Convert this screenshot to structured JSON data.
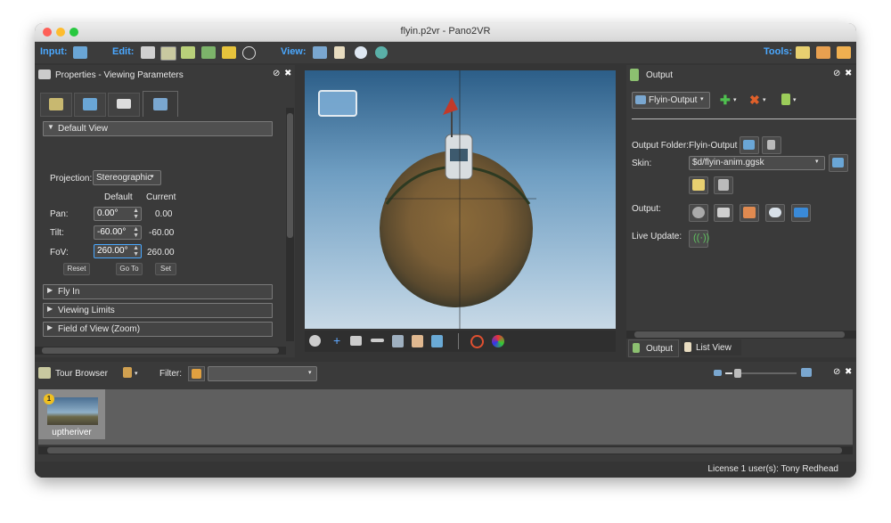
{
  "window": {
    "title": "flyin.p2vr - Pano2VR"
  },
  "toolbar": {
    "input_label": "Input:",
    "edit_label": "Edit:",
    "view_label": "View:",
    "tools_label": "Tools:"
  },
  "properties": {
    "title": "Properties - Viewing Parameters",
    "default_view": "Default View",
    "projection_label": "Projection:",
    "projection_value": "Stereographic",
    "col_default": "Default",
    "col_current": "Current",
    "pan_label": "Pan:",
    "pan_default": "0.00°",
    "pan_current": "0.00",
    "tilt_label": "Tilt:",
    "tilt_default": "-60.00°",
    "tilt_current": "-60.00",
    "fov_label": "FoV:",
    "fov_default": "260.00°",
    "fov_current": "260.00",
    "reset": "Reset",
    "goto": "Go To",
    "set": "Set",
    "fly_in": "Fly In",
    "viewing_limits": "Viewing Limits",
    "fov_zoom": "Field of View (Zoom)"
  },
  "output": {
    "title": "Output",
    "profile": "Flyin-Output",
    "folder_label": "Output Folder:",
    "folder_value": "Flyin-Output",
    "skin_label": "Skin:",
    "skin_value": "$d/flyin-anim.ggsk",
    "output_label": "Output:",
    "live_update_label": "Live Update:",
    "tab_output": "Output",
    "tab_listview": "List View"
  },
  "tour": {
    "title": "Tour Browser",
    "filter_label": "Filter:",
    "filter_value": "",
    "item_name": "uptheriver",
    "item_badge": "1"
  },
  "status": {
    "license": "License 1 user(s): Tony Redhead"
  },
  "colors": {
    "accent": "#4aa8ff",
    "bg": "#353535",
    "panel": "#3a3a3a"
  }
}
